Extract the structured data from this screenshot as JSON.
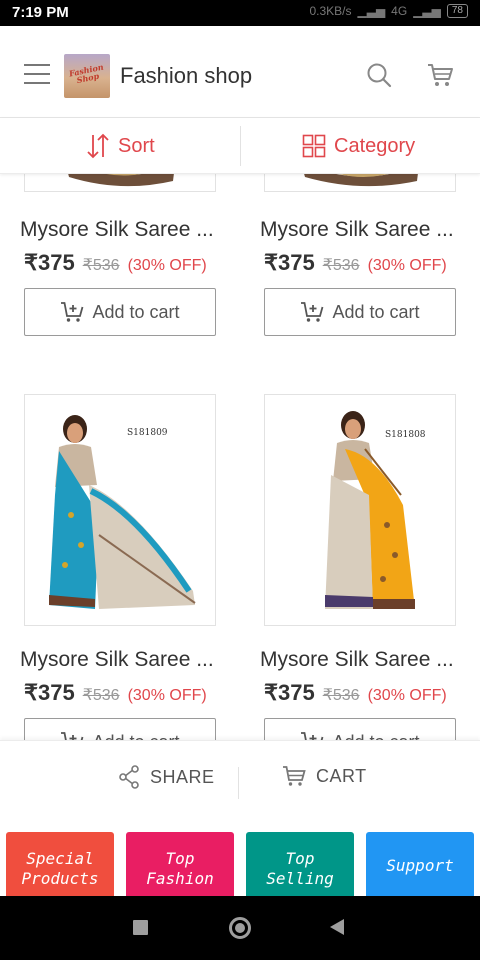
{
  "status_bar": {
    "time": "7:19 PM",
    "speed": "0.3KB/s",
    "network": "4G",
    "battery": "78"
  },
  "app_bar": {
    "logo_text": "Fashion Shop",
    "title": "Fashion shop",
    "icons": [
      "menu-icon",
      "search-icon",
      "cart-icon"
    ]
  },
  "filter_bar": {
    "sort_label": "Sort",
    "category_label": "Category",
    "accent_color": "#e0474c"
  },
  "products": [
    {
      "name": "Mysore Silk Saree ...",
      "price": "₹375",
      "mrp": "₹536",
      "discount": "(30% OFF)",
      "add_label": "Add to cart",
      "sku": ""
    },
    {
      "name": "Mysore Silk Saree ...",
      "price": "₹375",
      "mrp": "₹536",
      "discount": "(30% OFF)",
      "add_label": "Add to cart",
      "sku": ""
    },
    {
      "name": "Mysore Silk Saree ...",
      "price": "₹375",
      "mrp": "₹536",
      "discount": "(30% OFF)",
      "add_label": "Add to cart",
      "sku": "S181809",
      "saree_color": "#1f9bc0"
    },
    {
      "name": "Mysore Silk Saree ...",
      "price": "₹375",
      "mrp": "₹536",
      "discount": "(30% OFF)",
      "add_label": "Add to cart",
      "sku": "S181808",
      "saree_color": "#f2a516"
    }
  ],
  "action_bar": {
    "share_label": "SHARE",
    "cart_label": "CART"
  },
  "tiles": [
    {
      "line1": "Special",
      "line2": "Products",
      "color": "#f04e3e"
    },
    {
      "line1": "Top",
      "line2": "Fashion",
      "color": "#e91e63"
    },
    {
      "line1": "Top",
      "line2": "Selling",
      "color": "#009688"
    },
    {
      "line1": "Support",
      "line2": "",
      "color": "#2196f3"
    }
  ]
}
